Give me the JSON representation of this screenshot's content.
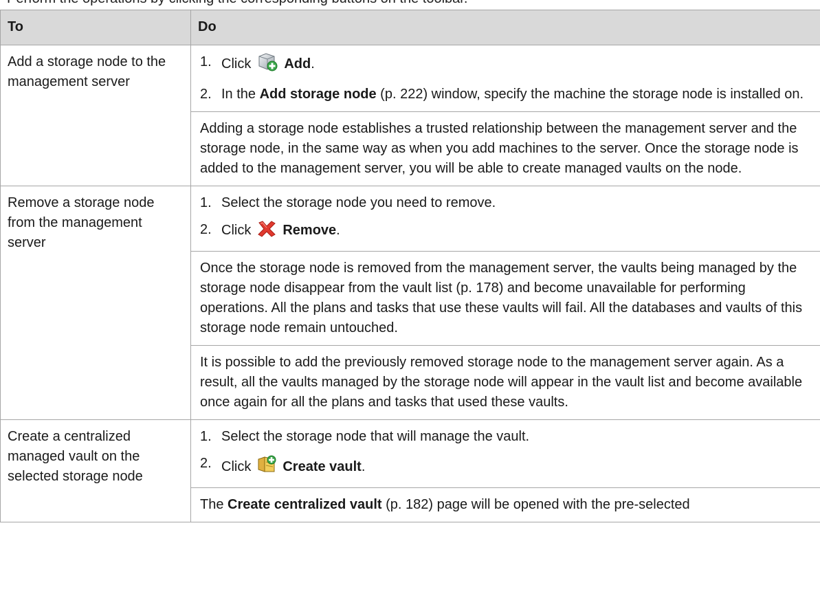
{
  "header": {
    "cut_text": "Perform the operations by clicking the corresponding buttons on the toolbar.",
    "col_to": "To",
    "col_do": "Do"
  },
  "rows": [
    {
      "to": "Add a storage node to the management server",
      "steps": [
        {
          "num": "1.",
          "pre": "Click",
          "icon": "add-storage-node-icon",
          "bold": "Add",
          "post": "."
        },
        {
          "num": "2.",
          "pre": "In the",
          "bold": "Add storage node",
          "post": " (p. 222) window, specify the machine the storage node is installed on."
        }
      ],
      "paragraphs": [
        "Adding a storage node establishes a trusted relationship between the management server and the storage node, in the same way as when you add machines to the server. Once the storage node is added to the management server, you will be able to create managed vaults on the node."
      ]
    },
    {
      "to": "Remove a storage node from the management server",
      "steps": [
        {
          "num": "1.",
          "text": "Select the storage node you need to remove."
        },
        {
          "num": "2.",
          "pre": "Click",
          "icon": "remove-x-icon",
          "bold": "Remove",
          "post": "."
        }
      ],
      "paragraphs": [
        "Once the storage node is removed from the management server, the vaults being managed by the storage node disappear from the vault list (p. 178) and become unavailable for performing operations. All the plans and tasks that use these vaults will fail. All the databases and vaults of this storage node remain untouched.",
        "It is possible to add the previously removed storage node to the management server again. As a result, all the vaults managed by the storage node will appear in the vault list and become available once again for all the plans and tasks that used these vaults."
      ]
    },
    {
      "to": "Create a centralized managed vault on the selected storage node",
      "steps": [
        {
          "num": "1.",
          "text": "Select the storage node that will manage the vault."
        },
        {
          "num": "2.",
          "pre": "Click",
          "icon": "create-vault-icon",
          "bold": "Create vault",
          "post": "."
        }
      ],
      "paragraphs_partial": {
        "pre": "The",
        "bold": "Create centralized vault",
        "post": " (p. 182) page will be opened with the pre-selected"
      }
    }
  ]
}
